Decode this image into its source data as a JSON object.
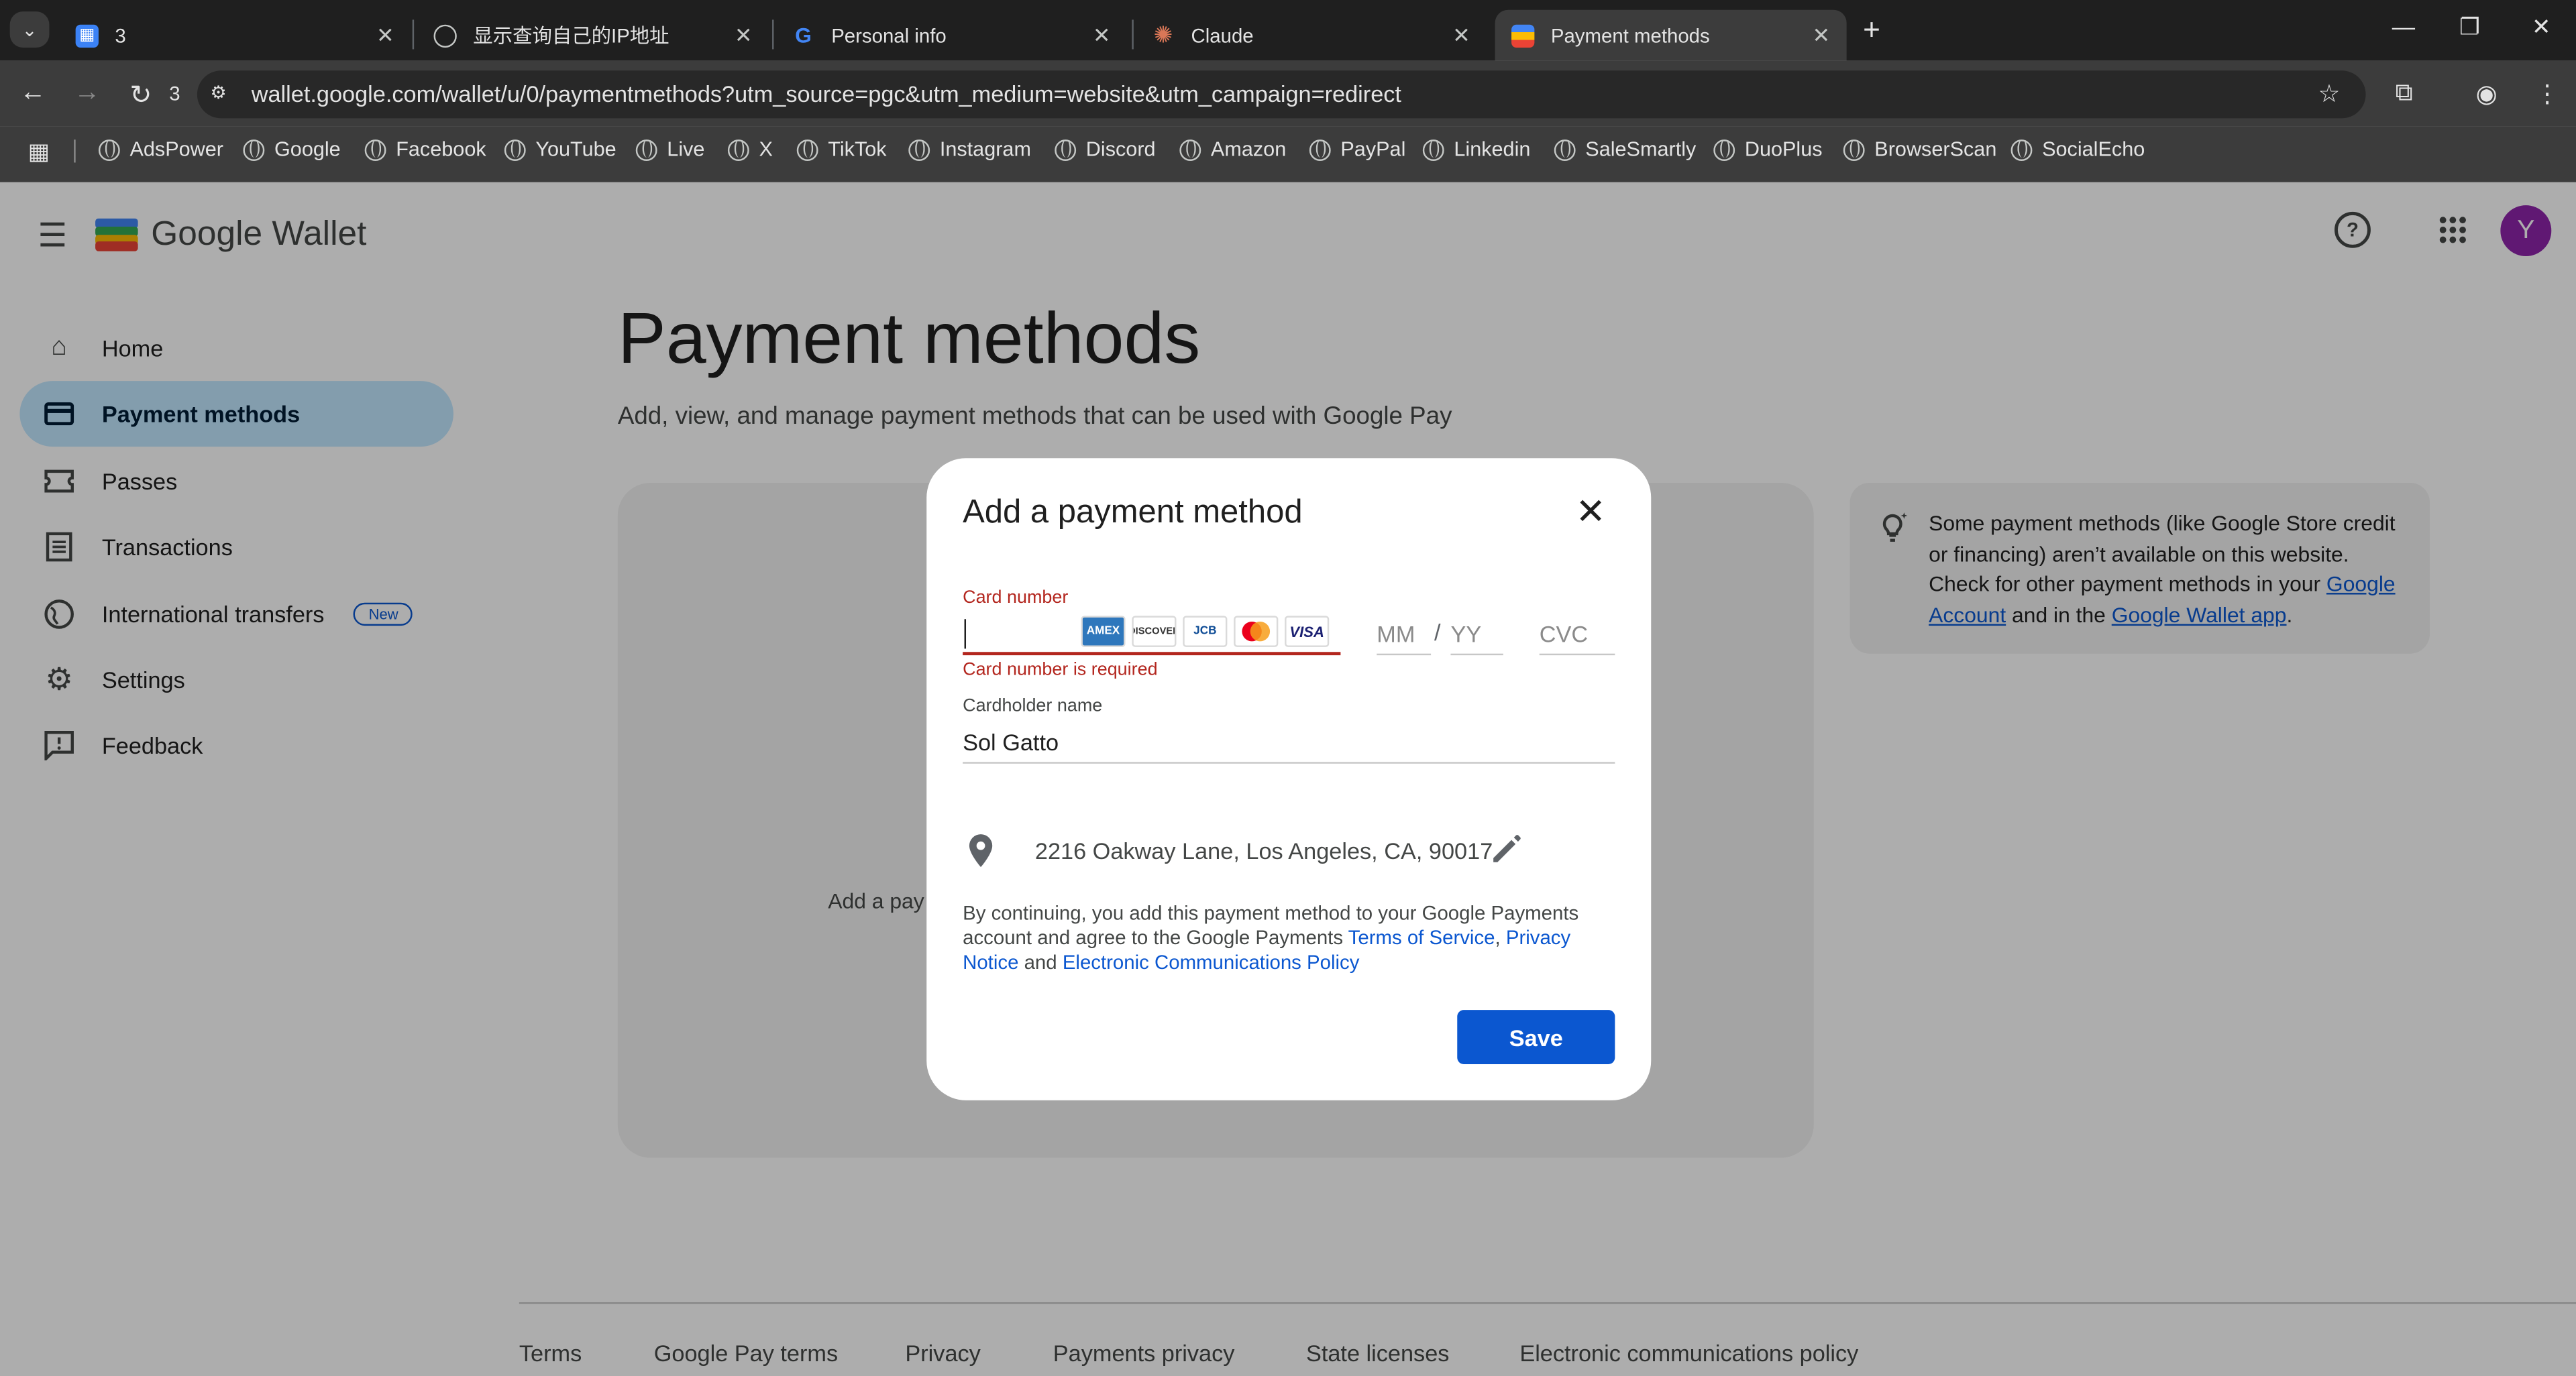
{
  "browser": {
    "tab_search_glyph": "⌄",
    "tabs": [
      {
        "title": "3",
        "favicon": "kanban-icon",
        "favicon_color": "#3b82f6"
      },
      {
        "title": "显示查询自己的IP地址",
        "favicon": "globe-icon",
        "favicon_color": "#c4c7c5"
      },
      {
        "title": "Personal info",
        "favicon": "google-g-icon",
        "favicon_color": "#4285f4"
      },
      {
        "title": "Claude",
        "favicon": "claude-icon",
        "favicon_color": "#d97757"
      },
      {
        "title": "Payment methods",
        "favicon": "wallet-icon",
        "favicon_color": "#4285f4",
        "active": true
      }
    ],
    "reload_count": "3",
    "url": "wallet.google.com/wallet/u/0/paymentmethods?utm_source=pgc&utm_medium=website&utm_campaign=redirect",
    "bookmarks": [
      "AdsPower",
      "Google",
      "Facebook",
      "YouTube",
      "Live",
      "X",
      "TikTok",
      "Instagram",
      "Discord",
      "Amazon",
      "PayPal",
      "Linkedin",
      "SaleSmartly",
      "DuoPlus",
      "BrowserScan",
      "SocialEcho"
    ]
  },
  "app": {
    "name": "Google Wallet",
    "avatar_letter": "Y",
    "avatar_color": "#8e24aa",
    "nav": [
      {
        "label": "Home",
        "icon": "home-icon"
      },
      {
        "label": "Payment methods",
        "icon": "credit-card-icon",
        "active": true
      },
      {
        "label": "Passes",
        "icon": "ticket-icon"
      },
      {
        "label": "Transactions",
        "icon": "receipt-icon"
      },
      {
        "label": "International transfers",
        "icon": "globe-icon",
        "badge": "New"
      },
      {
        "label": "Settings",
        "icon": "gear-icon"
      },
      {
        "label": "Feedback",
        "icon": "feedback-icon"
      }
    ]
  },
  "main": {
    "title": "Payment methods",
    "subtitle": "Add, view, and manage payment methods that can be used with Google Pay",
    "behind_text": "Add a pay",
    "info": {
      "text_before": "Some payment methods (like Google Store credit or financing) aren’t available on this website. Check for other payment methods in your ",
      "link1": "Google Account",
      "text_middle": " and in the ",
      "link2": "Google Wallet app",
      "text_after": "."
    }
  },
  "dialog": {
    "title": "Add a payment method",
    "card_number_label": "Card number",
    "card_number_value": "",
    "card_number_error": "Card number is required",
    "card_logos": [
      "AMEX",
      "DISCOVER",
      "JCB",
      "MasterCard",
      "VISA"
    ],
    "mm_placeholder": "MM",
    "slash": "/",
    "yy_placeholder": "YY",
    "cvc_placeholder": "CVC",
    "cardholder_label": "Cardholder name",
    "cardholder_value": "Sol Gatto",
    "address": "2216 Oakway Lane, Los Angeles, CA, 90017",
    "legal": {
      "part1": "By continuing, you add this payment method to your Google Payments account and agree to the Google Payments ",
      "tos": "Terms of Service",
      "comma": ", ",
      "privacy": "Privacy Notice",
      "and": " and ",
      "ecp": "Electronic Communications Policy"
    },
    "save_label": "Save"
  },
  "footer": {
    "links": [
      "Terms",
      "Google Pay terms",
      "Privacy",
      "Payments privacy",
      "State licenses",
      "Electronic communications policy"
    ]
  },
  "colors": {
    "accent": "#0b57d0",
    "error": "#b3261e",
    "nav_active_bg": "#c2e7ff"
  }
}
